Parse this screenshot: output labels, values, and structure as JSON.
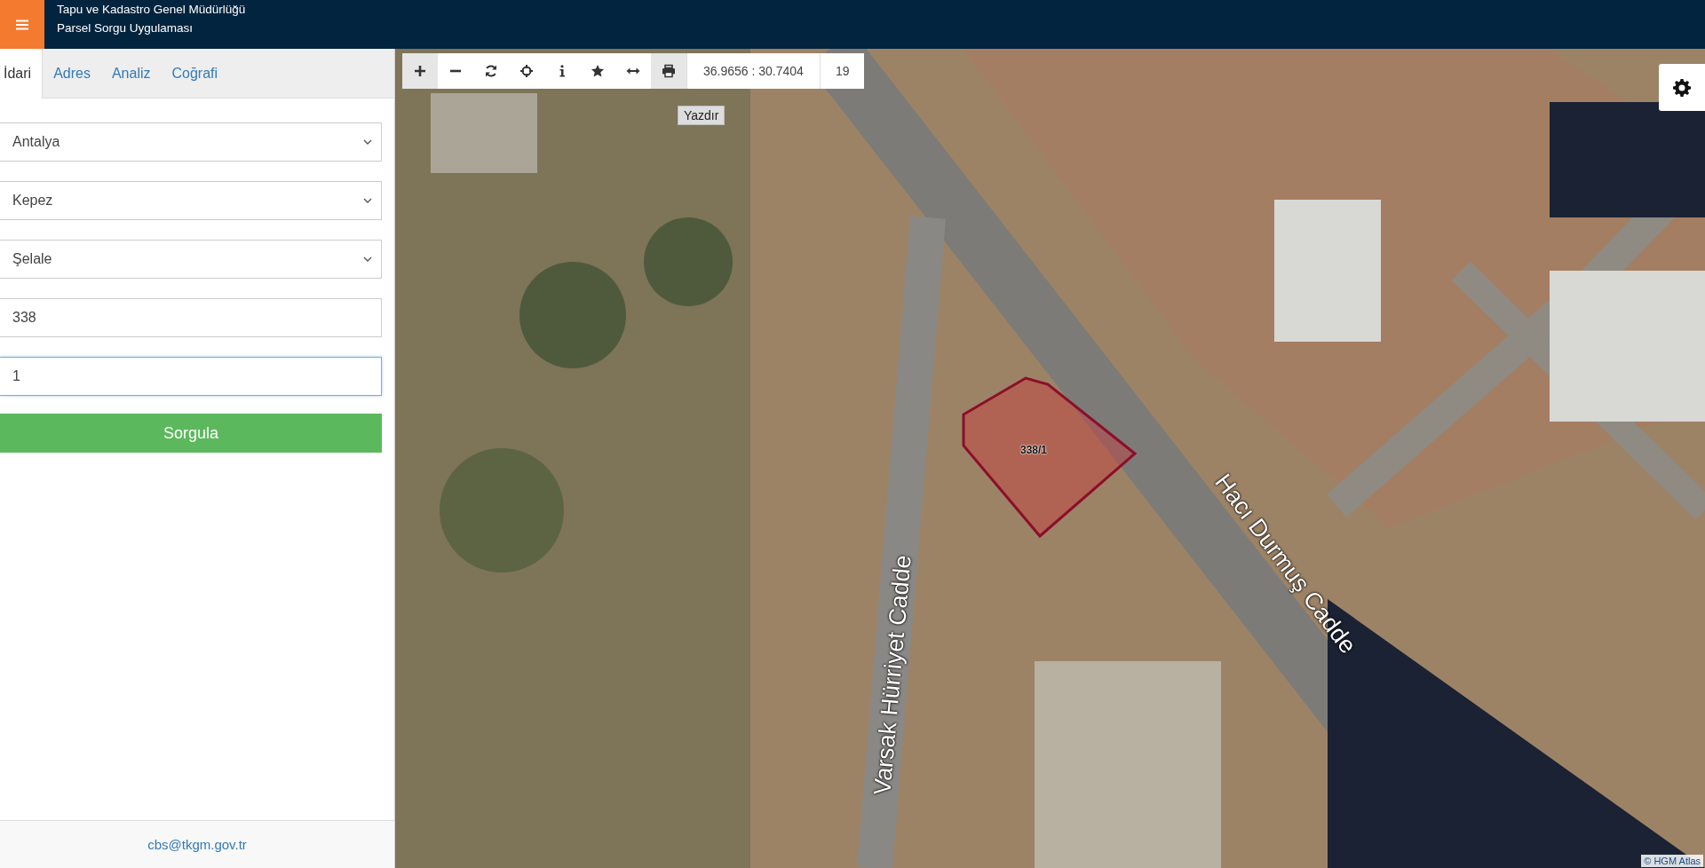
{
  "header": {
    "title": "Tapu ve Kadastro Genel Müdürlüğü",
    "subtitle": "Parsel Sorgu Uygulaması"
  },
  "tabs": [
    {
      "label": "İdari",
      "selected": true
    },
    {
      "label": "Adres",
      "selected": false
    },
    {
      "label": "Analiz",
      "selected": false
    },
    {
      "label": "Coğrafi",
      "selected": false
    }
  ],
  "form": {
    "fields": [
      {
        "kind": "select",
        "value": "Antalya",
        "focused": false
      },
      {
        "kind": "select",
        "value": "Kepez",
        "focused": false
      },
      {
        "kind": "select",
        "value": "Şelale",
        "focused": false
      },
      {
        "kind": "input",
        "value": "338",
        "focused": false
      },
      {
        "kind": "input",
        "value": "1",
        "focused": true
      }
    ],
    "submit": "Sorgula"
  },
  "footer": {
    "email": "cbs@tkgm.gov.tr"
  },
  "map": {
    "toolbar": {
      "tools": [
        {
          "kind": "zoom-in",
          "highlighted": true
        },
        {
          "kind": "zoom-out",
          "highlighted": false
        },
        {
          "kind": "refresh",
          "highlighted": false
        },
        {
          "kind": "locate",
          "highlighted": false
        },
        {
          "kind": "info",
          "highlighted": false
        },
        {
          "kind": "favorite",
          "highlighted": false
        },
        {
          "kind": "measure",
          "highlighted": false
        },
        {
          "kind": "print",
          "highlighted": true
        }
      ],
      "coordinates": "36.9656 : 30.7404",
      "zoom": "19",
      "tooltip": "Yazdır"
    },
    "parcel": {
      "label": "338/1"
    },
    "street_labels": [
      "Varsak Hürriyet Cadde",
      "Hacı Durmuş Cadde"
    ],
    "attribution": "© HGM Atlas"
  }
}
